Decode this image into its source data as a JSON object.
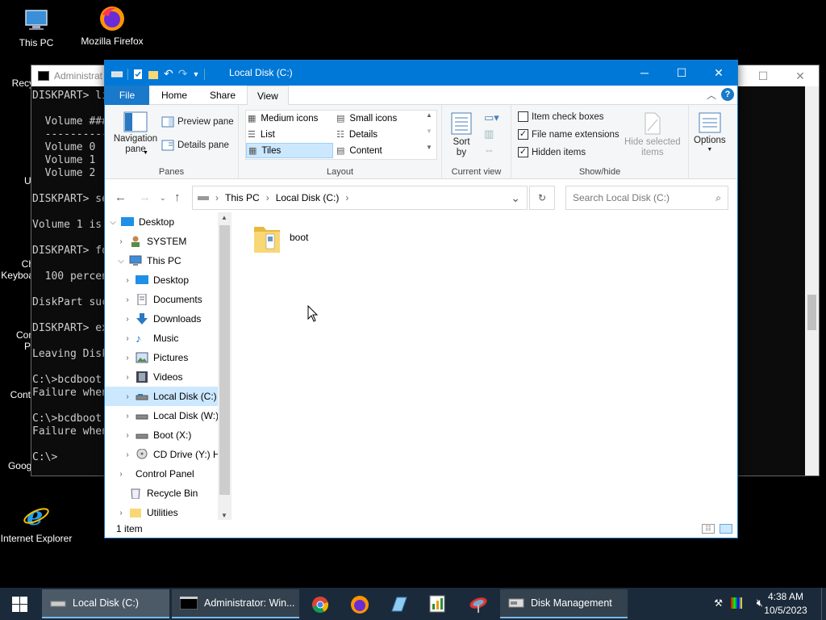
{
  "desktop": {
    "icons": [
      {
        "label": "This PC"
      },
      {
        "label": "Mozilla Firefox"
      },
      {
        "label": "Recy"
      },
      {
        "label": "Ut"
      },
      {
        "label": "Ch\nKeyboa"
      },
      {
        "label": "Con\nPr"
      },
      {
        "label": "Contr"
      },
      {
        "label": "Googl"
      },
      {
        "label": "Internet Explorer"
      }
    ]
  },
  "cmd": {
    "title": "Administrat",
    "lines": "DISKPART> li\n\n  Volume ###\n  ----------\n  Volume 0\n  Volume 1\n  Volume 2\n\nDISKPART> se\n\nVolume 1 is\n\nDISKPART> fo\n\n  100 percen\n\nDiskPart suc\n\nDISKPART> ex\n\nLeaving Disk\n\nC:\\>bcdboot\nFailure when\n\nC:\\>bcdboot\nFailure when\n\nC:\\>"
  },
  "explorer": {
    "title": "Local Disk (C:)",
    "tabs": {
      "file": "File",
      "home": "Home",
      "share": "Share",
      "view": "View"
    },
    "ribbon": {
      "panes": {
        "navigation_pane": "Navigation\npane",
        "preview_pane": "Preview pane",
        "details_pane": "Details pane",
        "label": "Panes"
      },
      "layout": {
        "items": [
          "Medium icons",
          "Small icons",
          "List",
          "Details",
          "Tiles",
          "Content"
        ],
        "selected": "Tiles",
        "label": "Layout"
      },
      "current_view": {
        "sort_by": "Sort\nby",
        "label": "Current view"
      },
      "show_hide": {
        "item_check_boxes": {
          "label": "Item check boxes",
          "checked": false
        },
        "file_name_extensions": {
          "label": "File name extensions",
          "checked": true
        },
        "hidden_items": {
          "label": "Hidden items",
          "checked": true
        },
        "hide_selected": "Hide selected\nitems",
        "label": "Show/hide"
      },
      "options": "Options"
    },
    "address": {
      "crumbs": [
        "This PC",
        "Local Disk (C:)"
      ]
    },
    "search": {
      "placeholder": "Search Local Disk (C:)"
    },
    "tree": [
      {
        "label": "Desktop",
        "level": 0,
        "expanded": true
      },
      {
        "label": "SYSTEM",
        "level": 1
      },
      {
        "label": "This PC",
        "level": 1,
        "expanded": true
      },
      {
        "label": "Desktop",
        "level": 2
      },
      {
        "label": "Documents",
        "level": 2
      },
      {
        "label": "Downloads",
        "level": 2
      },
      {
        "label": "Music",
        "level": 2
      },
      {
        "label": "Pictures",
        "level": 2
      },
      {
        "label": "Videos",
        "level": 2
      },
      {
        "label": "Local Disk (C:)",
        "level": 2,
        "selected": true
      },
      {
        "label": "Local Disk (W:)",
        "level": 2
      },
      {
        "label": "Boot (X:)",
        "level": 2
      },
      {
        "label": "CD Drive (Y:) H",
        "level": 2
      },
      {
        "label": "Control Panel",
        "level": 1
      },
      {
        "label": "Recycle Bin",
        "level": 1
      },
      {
        "label": "Utilities",
        "level": 1
      }
    ],
    "files": [
      {
        "name": "boot",
        "type": "folder"
      }
    ],
    "status": "1 item"
  },
  "taskbar": {
    "items": [
      {
        "label": "Local Disk (C:)"
      },
      {
        "label": "Administrator: Win..."
      },
      {
        "label": "Disk Management"
      }
    ],
    "clock": {
      "time": "4:38 AM",
      "date": "10/5/2023"
    }
  }
}
